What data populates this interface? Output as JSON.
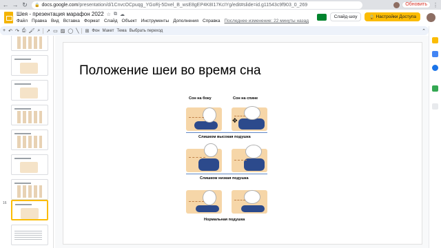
{
  "browser": {
    "back": "←",
    "forward": "→",
    "reload": "↻",
    "url_host": "docs.google.com",
    "url_path": "/presentation/d/1CnvcOCpuqg_YGoRj-5Dxel_B_wsE8gEP4K8I17KcIYg/edit#slide=id.g11543c9f903_0_269",
    "update_label": "Обновить",
    "menu_dots": "⋮"
  },
  "app": {
    "doc_title": "Шея - презентация марафон 2022",
    "star_icon": "☆",
    "move_icon": "⧉",
    "cloud_icon": "☁",
    "menu": [
      "Файл",
      "Правка",
      "Вид",
      "Вставка",
      "Формат",
      "Слайд",
      "Объект",
      "Инструменты",
      "Дополнения",
      "Справка"
    ],
    "last_edit": "Последнее изменение: 22 минуты назад",
    "slideshow_label": "Слайд-шоу",
    "access_label": "Настройки Доступа",
    "lock_glyph": "🔒"
  },
  "toolbar": {
    "add": "+",
    "undo": "↶",
    "redo": "↷",
    "print": "⎙",
    "paint": "🖌",
    "zoom": "⌕",
    "select": "➚",
    "textbox": "▭",
    "image": "▨",
    "shape": "◯",
    "line": "╲",
    "comment": "⊞",
    "background_label": "Фон",
    "layout_label": "Макет",
    "theme_label": "Тема",
    "transition_label": "Выбрать переход",
    "collapse": "⌃"
  },
  "filmstrip": {
    "slides": [
      {
        "num": "",
        "kind": "fig2"
      },
      {
        "num": "",
        "kind": "fig"
      },
      {
        "num": "",
        "kind": "fig"
      },
      {
        "num": "",
        "kind": "fig2"
      },
      {
        "num": "",
        "kind": "fig2"
      },
      {
        "num": "",
        "kind": "fig"
      },
      {
        "num": "",
        "kind": "fig2"
      },
      {
        "num": "16",
        "kind": "fig",
        "selected": true
      },
      {
        "num": "",
        "kind": "text"
      }
    ]
  },
  "slide": {
    "title": "Положение шеи во время сна",
    "label_side": "Сон на боку",
    "label_back": "Сон на спине",
    "label_high": "Слишком высокая подушка",
    "label_low": "Слишком низкая подушка",
    "label_normal": "Нормальная подушка",
    "cursor": "✥"
  },
  "colors": {
    "accent": "#fbbc04",
    "pillow": "#2c4a8c",
    "skin": "#f6d6a8"
  }
}
